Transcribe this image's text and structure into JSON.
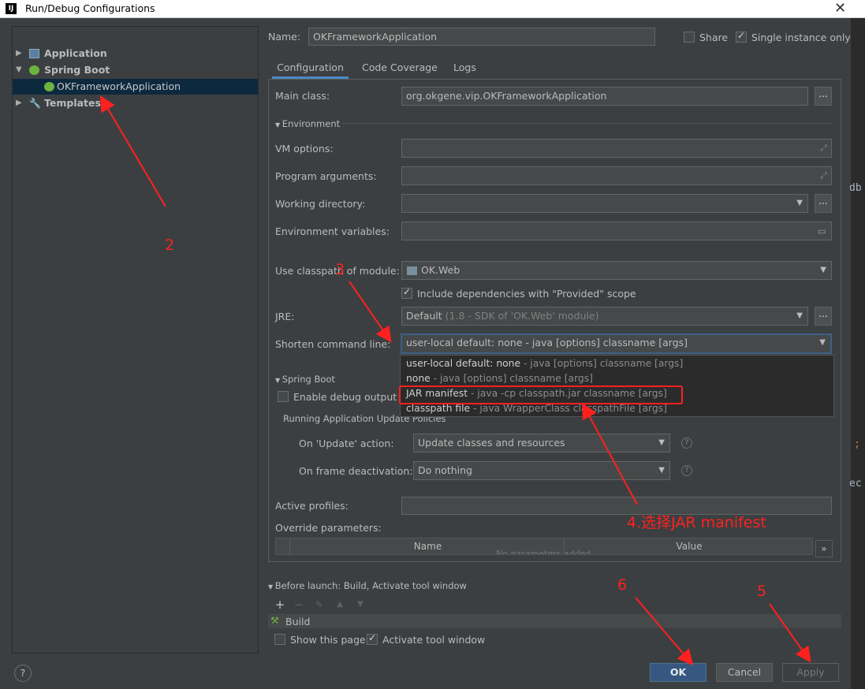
{
  "window": {
    "title": "Run/Debug Configurations",
    "logo": "IJ"
  },
  "left": {
    "tree": [
      {
        "label": "Application"
      },
      {
        "label": "Spring Boot"
      },
      {
        "label": "OKFrameworkApplication"
      },
      {
        "label": "Templates"
      }
    ]
  },
  "header": {
    "name_label": "Name:",
    "name_value": "OKFrameworkApplication",
    "share_label": "Share",
    "single_instance_label": "Single instance only",
    "share_checked": false,
    "single_instance_checked": true
  },
  "tabs": [
    {
      "label": "Configuration",
      "active": true
    },
    {
      "label": "Code Coverage",
      "active": false
    },
    {
      "label": "Logs",
      "active": false
    }
  ],
  "config": {
    "main_class_label": "Main class:",
    "main_class_value": "org.okgene.vip.OKFrameworkApplication",
    "environment_section": "Environment",
    "vm_options_label": "VM options:",
    "program_args_label": "Program arguments:",
    "working_dir_label": "Working directory:",
    "env_vars_label": "Environment variables:",
    "classpath_label": "Use classpath of module:",
    "classpath_value": "OK.Web",
    "include_deps_label": "Include dependencies with \"Provided\" scope",
    "jre_label": "JRE:",
    "jre_value_main": "Default",
    "jre_value_desc": "(1.8 - SDK of 'OK.Web' module)",
    "shorten_label": "Shorten command line:",
    "shorten_value": "user-local default: none - java [options] classname [args]",
    "spring_boot_section": "Spring Boot",
    "debug_output_label": "Enable debug output",
    "update_policies_label": "Running Application Update Policies",
    "on_update_label": "On 'Update' action:",
    "on_update_value": "Update classes and resources",
    "on_frame_label": "On frame deactivation:",
    "on_frame_value": "Do nothing",
    "active_profiles_label": "Active profiles:",
    "override_label": "Override parameters:",
    "table_col_name": "Name",
    "table_col_value": "Value",
    "table_empty": "No parameters added.",
    "more_button": "»"
  },
  "dropdown_options": [
    {
      "main": "user-local default: none",
      "desc": " - java [options] classname [args]"
    },
    {
      "main": "none",
      "desc": " - java [options] classname [args]"
    },
    {
      "main": "JAR manifest",
      "desc": " - java -cp classpath.jar classname [args]"
    },
    {
      "main": "classpath file",
      "desc": " - java WrapperClass classpathFile [args]"
    }
  ],
  "before_launch": {
    "section": "Before launch: Build, Activate tool window",
    "item": "Build",
    "show_page_label": "Show this page",
    "activate_label": "Activate tool window"
  },
  "footer": {
    "ok": "OK",
    "cancel": "Cancel",
    "apply": "Apply",
    "help": "?"
  },
  "annotations": {
    "n2": "2",
    "n3": "3",
    "n4": "4.选择JAR manifest",
    "n5": "5",
    "n6": "6"
  },
  "background_fragments": {
    "a": "db",
    "b": ";",
    "c": "ec"
  },
  "colors": {
    "accent": "#4a88c7",
    "selection": "#0d293e",
    "annotation": "#ff2020",
    "ok": "#365880"
  }
}
